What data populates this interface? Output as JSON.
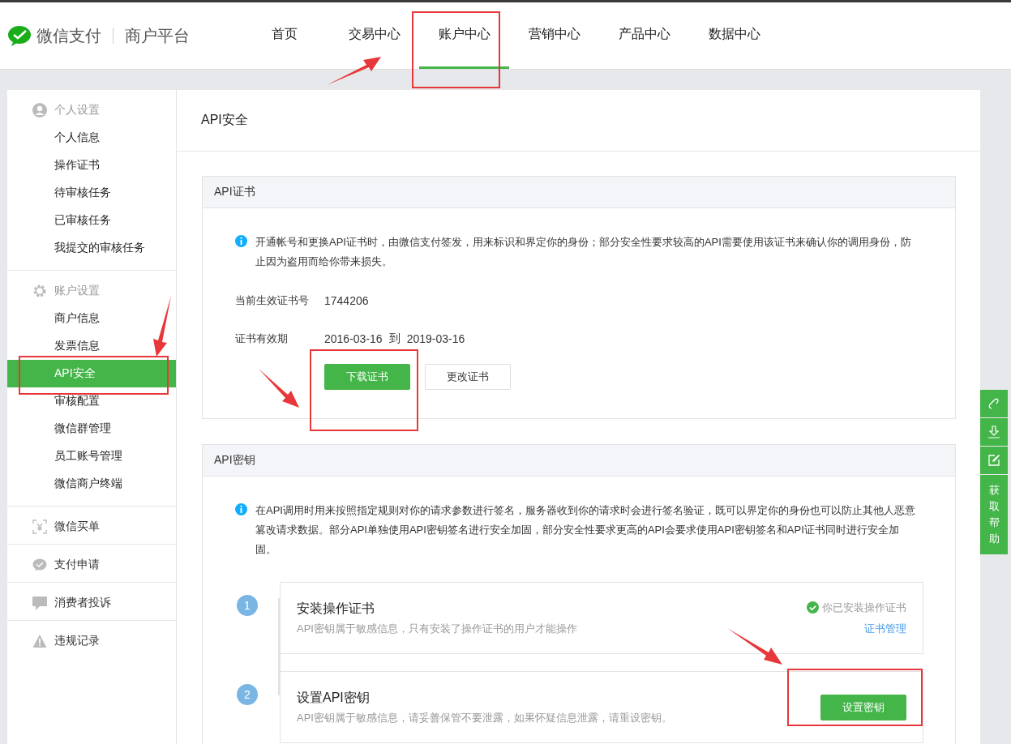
{
  "header": {
    "brand": "微信支付",
    "product": "商户平台",
    "nav": [
      {
        "label": "首页",
        "selected": false
      },
      {
        "label": "交易中心",
        "selected": false
      },
      {
        "label": "账户中心",
        "selected": true
      },
      {
        "label": "营销中心",
        "selected": false
      },
      {
        "label": "产品中心",
        "selected": false
      },
      {
        "label": "数据中心",
        "selected": false
      }
    ]
  },
  "sidebar": {
    "sections": [
      {
        "title": "个人设置",
        "items": [
          {
            "label": "个人信息",
            "selected": false
          },
          {
            "label": "操作证书",
            "selected": false
          },
          {
            "label": "待审核任务",
            "selected": false
          },
          {
            "label": "已审核任务",
            "selected": false
          },
          {
            "label": "我提交的审核任务",
            "selected": false
          }
        ]
      },
      {
        "title": "账户设置",
        "items": [
          {
            "label": "商户信息",
            "selected": false
          },
          {
            "label": "发票信息",
            "selected": false
          },
          {
            "label": "API安全",
            "selected": true
          },
          {
            "label": "审核配置",
            "selected": false
          },
          {
            "label": "微信群管理",
            "selected": false
          },
          {
            "label": "员工账号管理",
            "selected": false
          },
          {
            "label": "微信商户终端",
            "selected": false
          }
        ]
      },
      {
        "title": "微信买单"
      },
      {
        "title": "支付申请"
      },
      {
        "title": "消费者投诉"
      },
      {
        "title": "违规记录"
      }
    ]
  },
  "main": {
    "title": "API安全",
    "cert_card": {
      "title": "API证书",
      "notice": "开通帐号和更换API证书时，由微信支付签发，用来标识和界定你的身份；部分安全性要求较高的API需要使用该证书来确认你的调用身份，防止因为盗用而给你带来损失。",
      "fields": [
        {
          "label": "当前生效证书号",
          "values": [
            "1744206"
          ]
        },
        {
          "label": "证书有效期",
          "values": [
            "2016-03-16",
            "到",
            "2019-03-16"
          ]
        }
      ],
      "buttons": [
        {
          "label": "下载证书",
          "kind": "primary"
        },
        {
          "label": "更改证书",
          "kind": "secondary"
        }
      ]
    },
    "key_card": {
      "title": "API密钥",
      "notice": "在API调用时用来按照指定规则对你的请求参数进行签名，服务器收到你的请求时会进行签名验证，既可以界定你的身份也可以防止其他人恶意篡改请求数据。部分API单独使用API密钥签名进行安全加固，部分安全性要求更高的API会要求使用API密钥签名和API证书同时进行安全加固。",
      "steps": [
        {
          "number": "1",
          "title": "安装操作证书",
          "desc": "API密钥属于敏感信息，只有安装了操作证书的用户才能操作",
          "kind": "status",
          "status": "你已安装操作证书",
          "link": "证书管理"
        },
        {
          "number": "2",
          "title": "设置API密钥",
          "desc": "API密钥属于敏感信息，请妥善保管不要泄露，如果怀疑信息泄露，请重设密钥。",
          "kind": "button",
          "button": "设置密钥"
        }
      ]
    }
  },
  "float_toolbar": {
    "help": "获取帮助"
  }
}
